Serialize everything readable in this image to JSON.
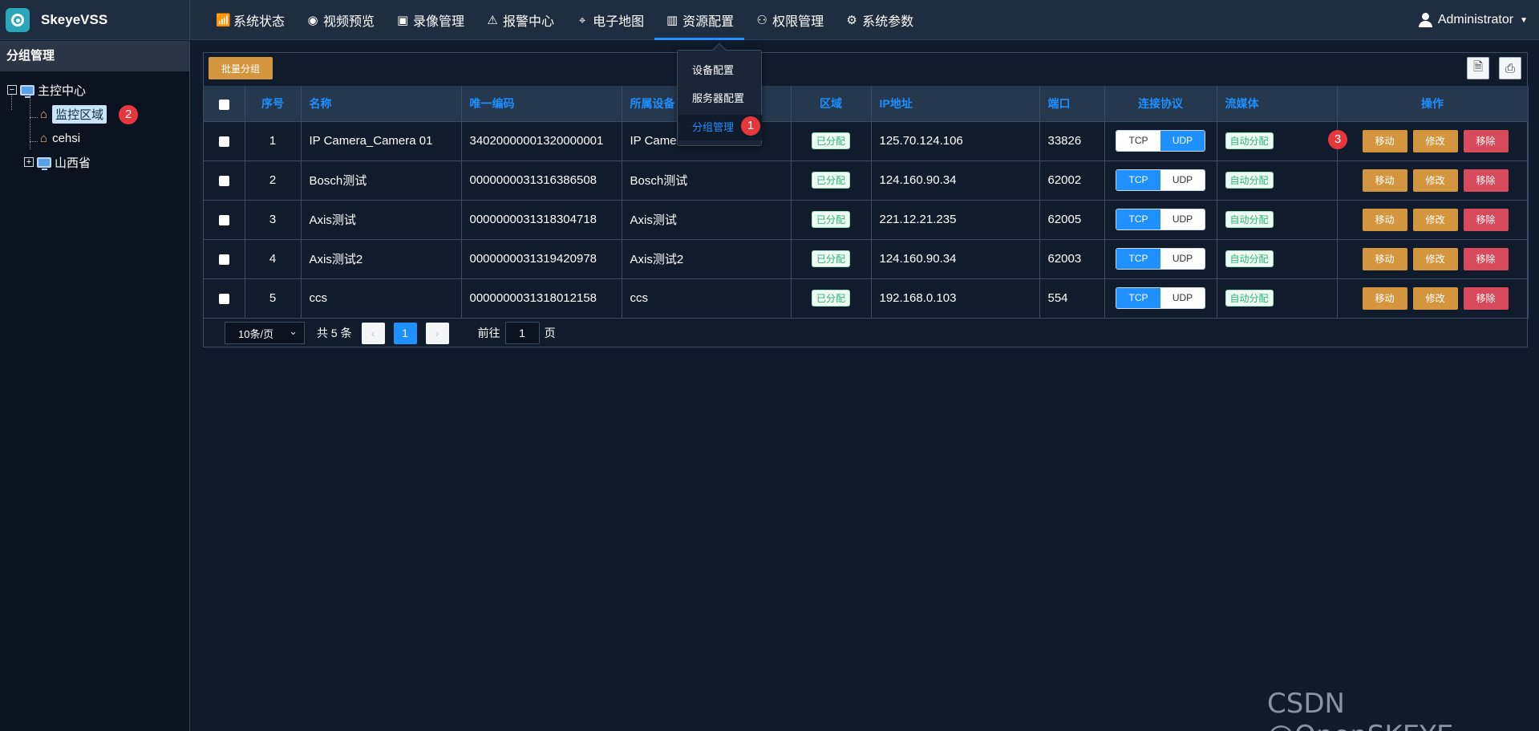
{
  "header": {
    "app_name": "SkeyeVSS",
    "user": "Administrator",
    "nav": [
      {
        "label": "系统状态",
        "icon": "chart-icon"
      },
      {
        "label": "视频预览",
        "icon": "camera-icon"
      },
      {
        "label": "录像管理",
        "icon": "film-icon"
      },
      {
        "label": "报警中心",
        "icon": "alarm-icon"
      },
      {
        "label": "电子地图",
        "icon": "map-icon"
      },
      {
        "label": "资源配置",
        "icon": "resource-icon",
        "active": true
      },
      {
        "label": "权限管理",
        "icon": "user-key-icon"
      },
      {
        "label": "系统参数",
        "icon": "gear-icon"
      }
    ]
  },
  "dropdown": {
    "items": [
      "设备配置",
      "服务器配置",
      "分组管理"
    ],
    "active_index": 2
  },
  "sidebar": {
    "title": "分组管理",
    "tree": {
      "root": "主控中心",
      "children": [
        "监控区域",
        "cehsi"
      ],
      "sibling": "山西省",
      "selected": "监控区域"
    }
  },
  "badges": [
    "1",
    "2",
    "3"
  ],
  "toolbar": {
    "batch_button": "批量分组"
  },
  "table": {
    "columns": [
      "序号",
      "名称",
      "唯一编码",
      "所属设备",
      "区域",
      "IP地址",
      "端口",
      "连接协议",
      "流媒体",
      "操作"
    ],
    "rows": [
      {
        "no": "1",
        "name": "IP Camera_Camera 01",
        "code": "34020000001320000001",
        "device": "IP Camera",
        "area": "已分配",
        "ip": "125.70.124.106",
        "port": "33826",
        "protocol": "UDP",
        "media": "自动分配"
      },
      {
        "no": "2",
        "name": "Bosch测试",
        "code": "0000000031316386508",
        "device": "Bosch测试",
        "area": "已分配",
        "ip": "124.160.90.34",
        "port": "62002",
        "protocol": "TCP",
        "media": "自动分配"
      },
      {
        "no": "3",
        "name": "Axis测试",
        "code": "0000000031318304718",
        "device": "Axis测试",
        "area": "已分配",
        "ip": "221.12.21.235",
        "port": "62005",
        "protocol": "TCP",
        "media": "自动分配"
      },
      {
        "no": "4",
        "name": "Axis测试2",
        "code": "0000000031319420978",
        "device": "Axis测试2",
        "area": "已分配",
        "ip": "124.160.90.34",
        "port": "62003",
        "protocol": "TCP",
        "media": "自动分配"
      },
      {
        "no": "5",
        "name": "ccs",
        "code": "0000000031318012158",
        "device": "ccs",
        "area": "已分配",
        "ip": "192.168.0.103",
        "port": "554",
        "protocol": "TCP",
        "media": "自动分配"
      }
    ],
    "protocol_options": [
      "TCP",
      "UDP"
    ],
    "actions": [
      "移动",
      "修改",
      "移除"
    ]
  },
  "pagination": {
    "page_size": "10条/页",
    "total": "共 5 条",
    "current": "1",
    "goto_label": "前往",
    "goto_value": "1",
    "page_unit": "页"
  },
  "watermark": "CSDN @OpenSKEYE",
  "colors": {
    "accent": "#1e90ff",
    "warning": "#d3963f",
    "danger": "#d74a5b",
    "success": "#2bb673",
    "badge": "#e8373c"
  }
}
